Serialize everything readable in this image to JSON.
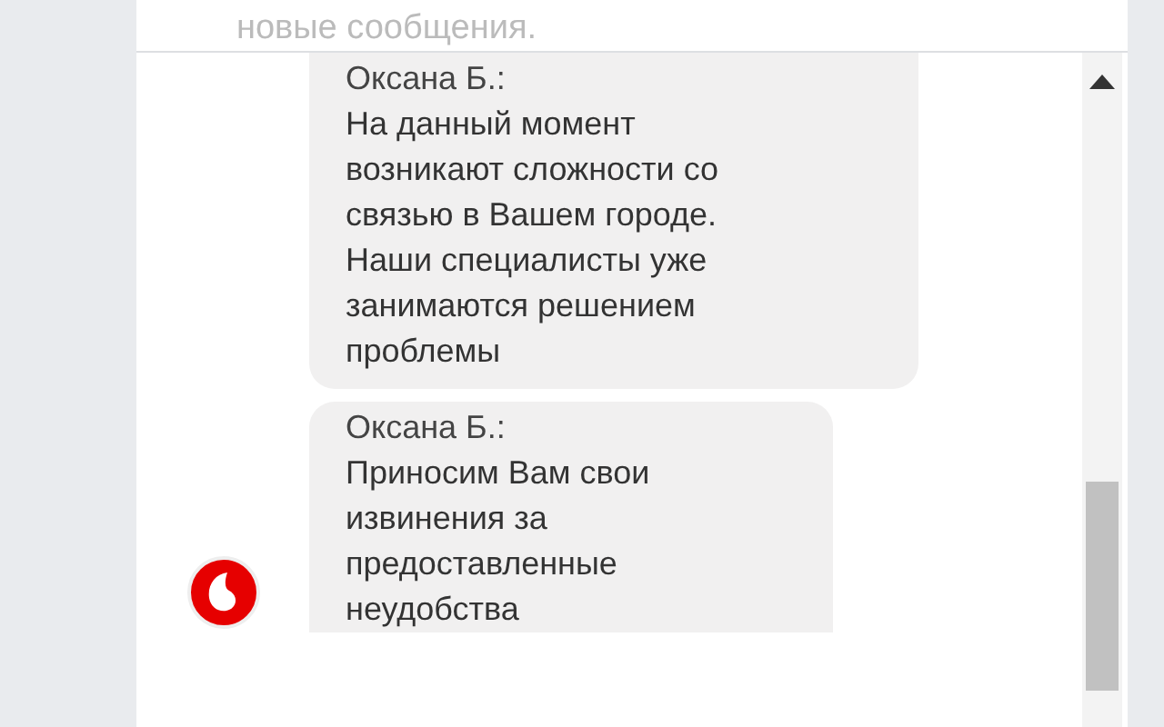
{
  "header": {
    "text": "новые сообщения."
  },
  "messages": [
    {
      "sender": "Оксана Б.:",
      "text": " На данный момент\nвозникают сложности со\nсвязью в Вашем городе.\nНаши специалисты уже\nзанимаются решением\nпроблемы",
      "avatar": false
    },
    {
      "sender": "Оксана Б.:",
      "text": " Приносим Вам свои\nизвинения за\nпредоставленные\nнеудобства",
      "avatar": true
    }
  ]
}
